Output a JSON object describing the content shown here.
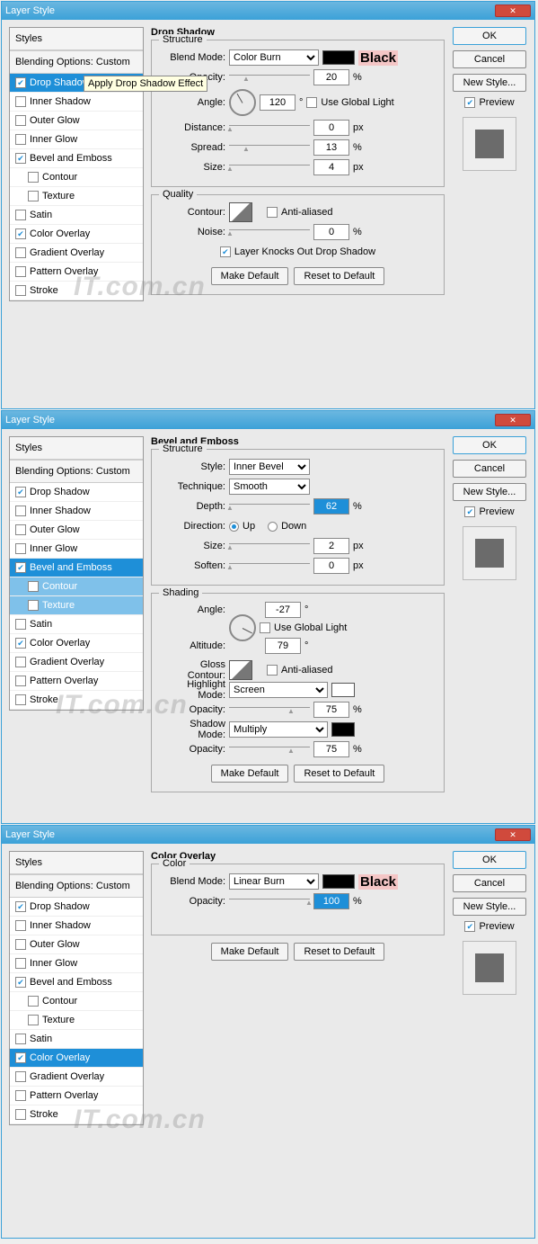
{
  "dialogs": [
    {
      "title": "Layer Style",
      "styles_header": "Styles",
      "blending": "Blending Options: Custom",
      "panel_title": "Drop Shadow",
      "tooltip": "Apply Drop Shadow Effect",
      "styles": [
        {
          "label": "Drop Shadow",
          "checked": true,
          "selected": true
        },
        {
          "label": "Inner Shadow",
          "checked": false
        },
        {
          "label": "Outer Glow",
          "checked": false
        },
        {
          "label": "Inner Glow",
          "checked": false
        },
        {
          "label": "Bevel and Emboss",
          "checked": true
        },
        {
          "label": "Contour",
          "checked": false,
          "sub": true
        },
        {
          "label": "Texture",
          "checked": false,
          "sub": true
        },
        {
          "label": "Satin",
          "checked": false
        },
        {
          "label": "Color Overlay",
          "checked": true
        },
        {
          "label": "Gradient Overlay",
          "checked": false
        },
        {
          "label": "Pattern Overlay",
          "checked": false
        },
        {
          "label": "Stroke",
          "checked": false
        }
      ],
      "structure": {
        "legend": "Structure",
        "blend_mode_label": "Blend Mode:",
        "blend_mode": "Color Burn",
        "annot": "Black",
        "opacity_label": "Opacity:",
        "opacity": "20",
        "opacity_unit": "%",
        "angle_label": "Angle:",
        "angle": "120",
        "angle_unit": "°",
        "global_light": "Use Global Light",
        "global_light_on": false,
        "distance_label": "Distance:",
        "distance": "0",
        "distance_unit": "px",
        "spread_label": "Spread:",
        "spread": "13",
        "spread_unit": "%",
        "size_label": "Size:",
        "size": "4",
        "size_unit": "px"
      },
      "quality": {
        "legend": "Quality",
        "contour_label": "Contour:",
        "anti_aliased": "Anti-aliased",
        "anti_on": false,
        "noise_label": "Noise:",
        "noise": "0",
        "noise_unit": "%",
        "knockout": "Layer Knocks Out Drop Shadow",
        "knockout_on": true
      },
      "buttons": {
        "make_default": "Make Default",
        "reset": "Reset to Default"
      },
      "right": {
        "ok": "OK",
        "cancel": "Cancel",
        "new_style": "New Style...",
        "preview": "Preview"
      }
    },
    {
      "title": "Layer Style",
      "styles_header": "Styles",
      "blending": "Blending Options: Custom",
      "panel_title": "Bevel and Emboss",
      "styles": [
        {
          "label": "Drop Shadow",
          "checked": true
        },
        {
          "label": "Inner Shadow",
          "checked": false
        },
        {
          "label": "Outer Glow",
          "checked": false
        },
        {
          "label": "Inner Glow",
          "checked": false
        },
        {
          "label": "Bevel and Emboss",
          "checked": true,
          "selected": true
        },
        {
          "label": "Contour",
          "checked": false,
          "sub": true,
          "subsel": true
        },
        {
          "label": "Texture",
          "checked": false,
          "sub": true,
          "subsel": true
        },
        {
          "label": "Satin",
          "checked": false
        },
        {
          "label": "Color Overlay",
          "checked": true
        },
        {
          "label": "Gradient Overlay",
          "checked": false
        },
        {
          "label": "Pattern Overlay",
          "checked": false
        },
        {
          "label": "Stroke",
          "checked": false
        }
      ],
      "structure": {
        "legend": "Structure",
        "style_label": "Style:",
        "style": "Inner Bevel",
        "technique_label": "Technique:",
        "technique": "Smooth",
        "depth_label": "Depth:",
        "depth": "62",
        "depth_unit": "%",
        "direction_label": "Direction:",
        "up": "Up",
        "down": "Down",
        "dir": "up",
        "size_label": "Size:",
        "size": "2",
        "size_unit": "px",
        "soften_label": "Soften:",
        "soften": "0",
        "soften_unit": "px"
      },
      "shading": {
        "legend": "Shading",
        "angle_label": "Angle:",
        "angle": "-27",
        "angle_unit": "°",
        "global_light": "Use Global Light",
        "global_on": false,
        "altitude_label": "Altitude:",
        "altitude": "79",
        "altitude_unit": "°",
        "gloss_label": "Gloss Contour:",
        "anti": "Anti-aliased",
        "anti_on": false,
        "highlight_mode_label": "Highlight Mode:",
        "highlight_mode": "Screen",
        "hl_opacity_label": "Opacity:",
        "hl_opacity": "75",
        "hl_unit": "%",
        "shadow_mode_label": "Shadow Mode:",
        "shadow_mode": "Multiply",
        "sh_opacity_label": "Opacity:",
        "sh_opacity": "75",
        "sh_unit": "%"
      },
      "buttons": {
        "make_default": "Make Default",
        "reset": "Reset to Default"
      },
      "right": {
        "ok": "OK",
        "cancel": "Cancel",
        "new_style": "New Style...",
        "preview": "Preview"
      }
    },
    {
      "title": "Layer Style",
      "styles_header": "Styles",
      "blending": "Blending Options: Custom",
      "panel_title": "Color Overlay",
      "styles": [
        {
          "label": "Drop Shadow",
          "checked": true
        },
        {
          "label": "Inner Shadow",
          "checked": false
        },
        {
          "label": "Outer Glow",
          "checked": false
        },
        {
          "label": "Inner Glow",
          "checked": false
        },
        {
          "label": "Bevel and Emboss",
          "checked": true
        },
        {
          "label": "Contour",
          "checked": false,
          "sub": true
        },
        {
          "label": "Texture",
          "checked": false,
          "sub": true
        },
        {
          "label": "Satin",
          "checked": false
        },
        {
          "label": "Color Overlay",
          "checked": true,
          "selected": true
        },
        {
          "label": "Gradient Overlay",
          "checked": false
        },
        {
          "label": "Pattern Overlay",
          "checked": false
        },
        {
          "label": "Stroke",
          "checked": false
        }
      ],
      "color": {
        "legend": "Color",
        "blend_mode_label": "Blend Mode:",
        "blend_mode": "Linear Burn",
        "annot": "Black",
        "opacity_label": "Opacity:",
        "opacity": "100",
        "opacity_unit": "%"
      },
      "buttons": {
        "make_default": "Make Default",
        "reset": "Reset to Default"
      },
      "right": {
        "ok": "OK",
        "cancel": "Cancel",
        "new_style": "New Style...",
        "preview": "Preview"
      }
    }
  ],
  "watermark": "IT.com.cn"
}
